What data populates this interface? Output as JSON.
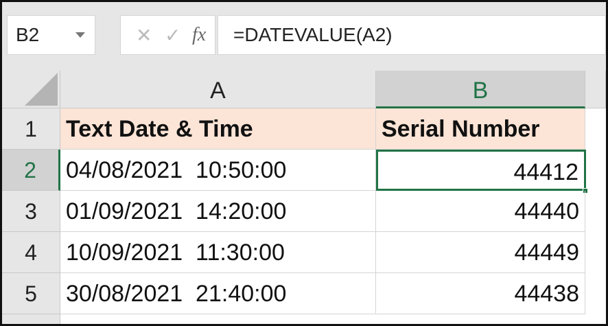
{
  "name_box": {
    "value": "B2"
  },
  "formula_bar": {
    "cancel_icon": "✕",
    "enter_icon": "✓",
    "fx_label": "fx",
    "formula": "=DATEVALUE(A2)"
  },
  "columns": [
    "A",
    "B"
  ],
  "rows": [
    {
      "num": "1",
      "a": "Text Date & Time",
      "b": "Serial Number"
    },
    {
      "num": "2",
      "a": "04/08/2021  10:50:00",
      "b": "44412"
    },
    {
      "num": "3",
      "a": "01/09/2021  14:20:00",
      "b": "44440"
    },
    {
      "num": "4",
      "a": "10/09/2021  11:30:00",
      "b": "44449"
    },
    {
      "num": "5",
      "a": "30/08/2021  21:40:00",
      "b": "44438"
    }
  ],
  "colors": {
    "accent": "#217346",
    "header_fill": "#fce4d6"
  }
}
